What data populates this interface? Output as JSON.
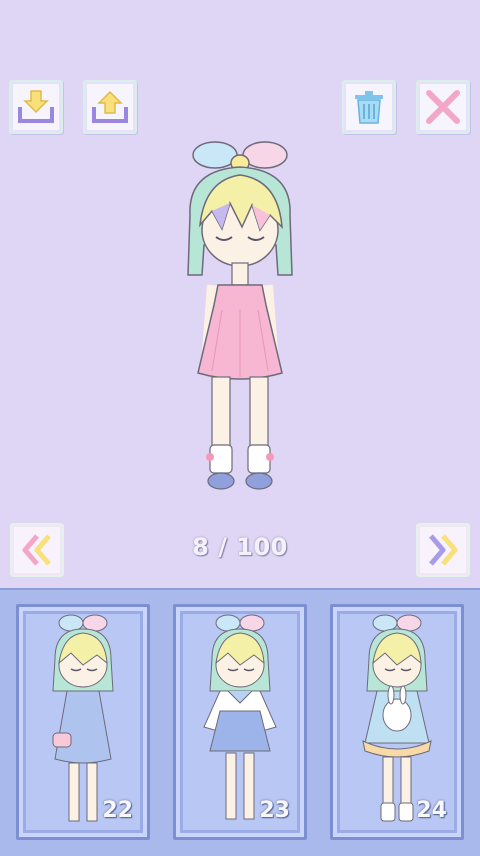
{
  "toolbar": {
    "buttons": [
      {
        "name": "save-icon"
      },
      {
        "name": "share-icon"
      },
      {
        "name": "trash-icon"
      },
      {
        "name": "close-icon"
      }
    ]
  },
  "navigation": {
    "prev_icon": "double-chevron-left-icon",
    "next_icon": "double-chevron-right-icon"
  },
  "counter": {
    "text": "8 / 100"
  },
  "outfits": [
    {
      "number": "22"
    },
    {
      "number": "23"
    },
    {
      "number": "24"
    }
  ],
  "colors": {
    "background": "#ded6f4",
    "tray": "#a9b9ec",
    "card": "#b8c7f4",
    "dress_pink": "#f7b6d2"
  }
}
